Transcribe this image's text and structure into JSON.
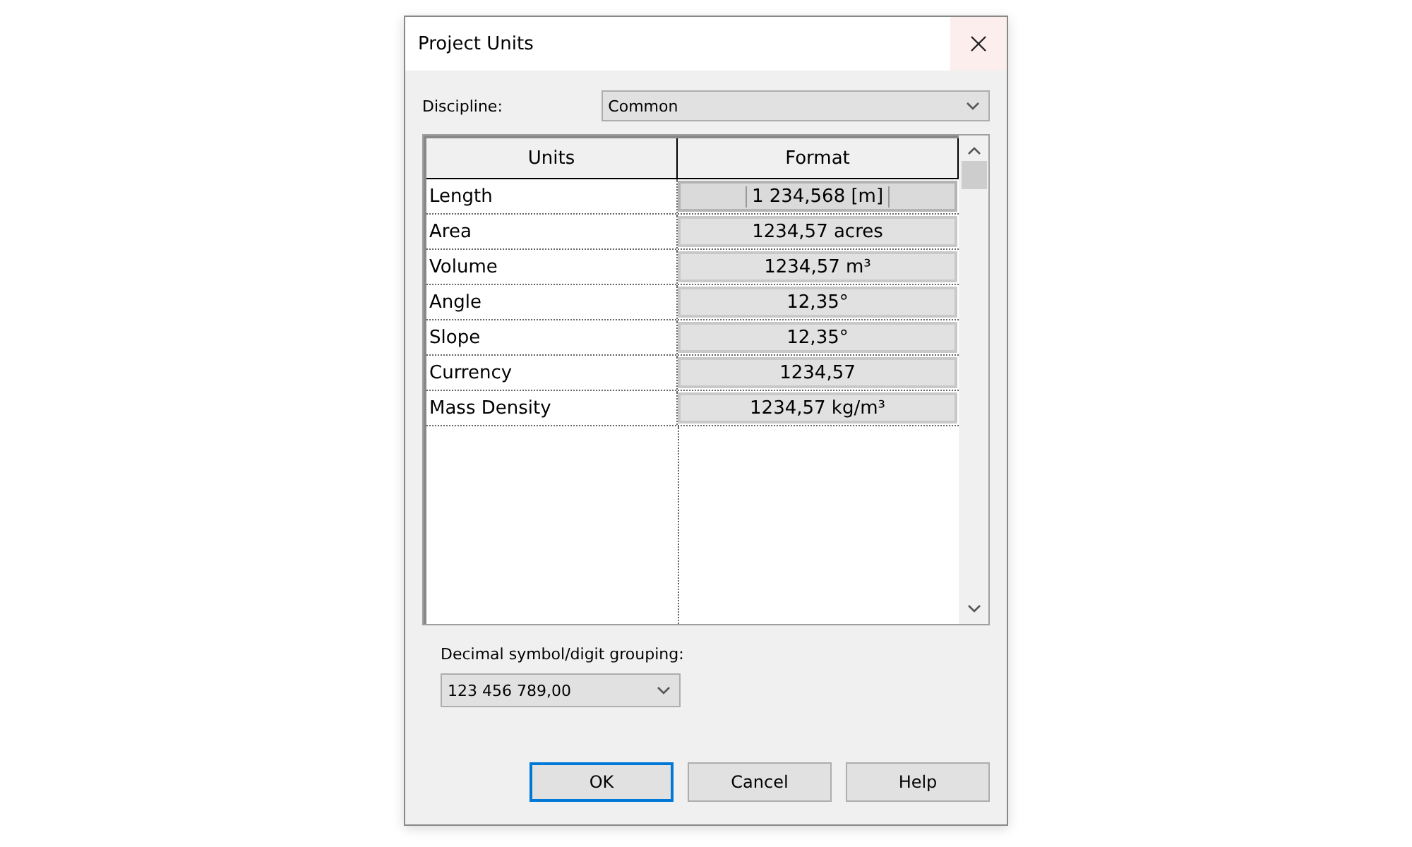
{
  "window": {
    "title": "Project Units"
  },
  "discipline": {
    "label": "Discipline:",
    "value": "Common"
  },
  "table": {
    "columns": [
      "Units",
      "Format"
    ],
    "rows": [
      {
        "unit": "Length",
        "format": "1 234,568 [m]",
        "focused": true
      },
      {
        "unit": "Area",
        "format": "1234,57 acres",
        "focused": false
      },
      {
        "unit": "Volume",
        "format": "1234,57 m³",
        "focused": false
      },
      {
        "unit": "Angle",
        "format": "12,35°",
        "focused": false
      },
      {
        "unit": "Slope",
        "format": "12,35°",
        "focused": false
      },
      {
        "unit": "Currency",
        "format": "1234,57",
        "focused": false
      },
      {
        "unit": "Mass Density",
        "format": "1234,57 kg/m³",
        "focused": false
      }
    ]
  },
  "grouping": {
    "label": "Decimal symbol/digit grouping:",
    "value": "123 456 789,00"
  },
  "buttons": [
    {
      "label": "OK",
      "default": true
    },
    {
      "label": "Cancel",
      "default": false
    },
    {
      "label": "Help",
      "default": false
    }
  ]
}
